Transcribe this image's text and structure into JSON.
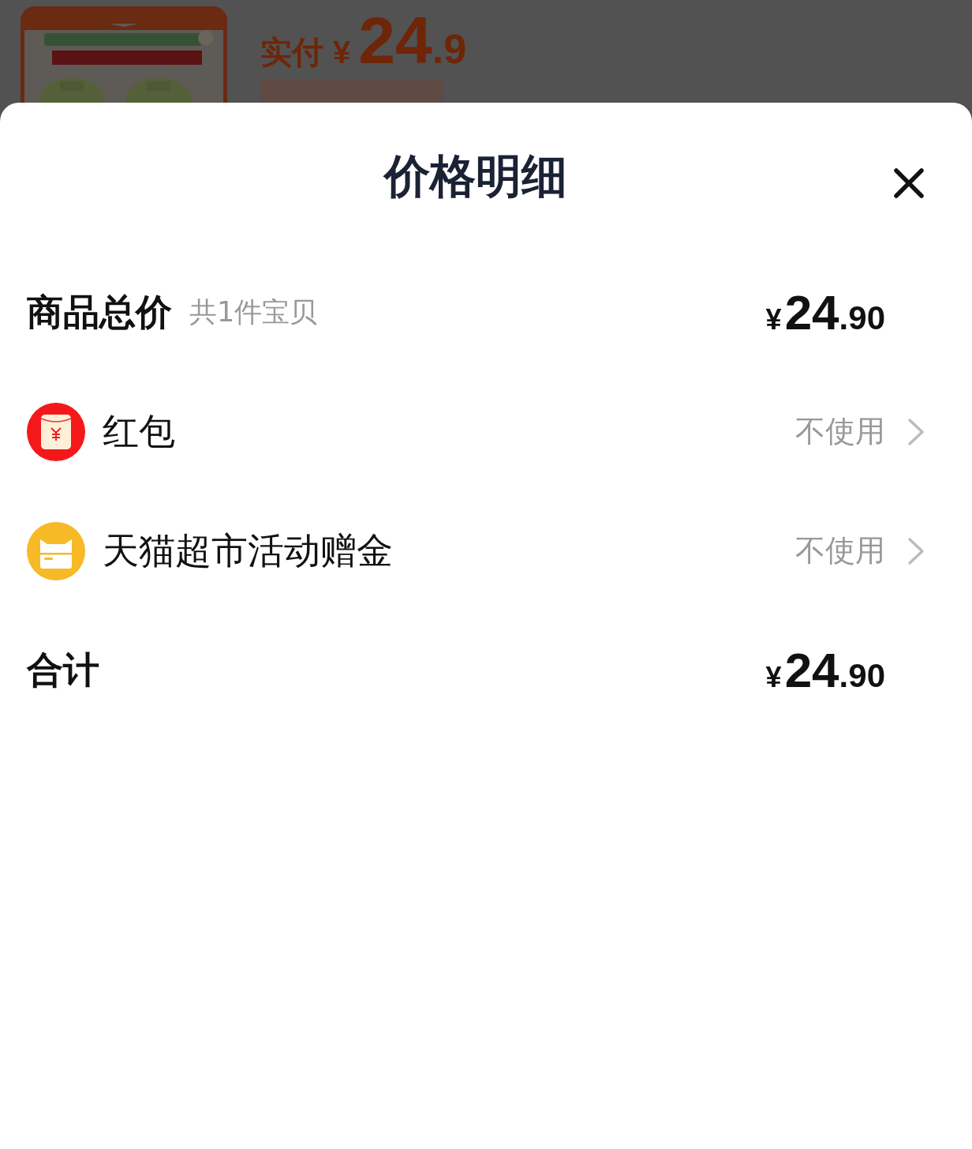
{
  "background_page": {
    "paid_label": "实付",
    "price": {
      "currency": "¥",
      "integer": "24",
      "decimal": ".9"
    },
    "detail_button": {
      "kind": "cut"
    }
  },
  "sheet": {
    "title": "价格明细",
    "rows": [
      {
        "kind": "total",
        "label": "商品总价",
        "note": "共1件宝贝",
        "price": {
          "currency": "¥",
          "integer": "24",
          "decimal": ".90"
        }
      },
      {
        "kind": "option",
        "label": "红包",
        "value": "不使用"
      },
      {
        "kind": "option",
        "label": "天猫超市活动赠金",
        "value": "不使用"
      },
      {
        "kind": "total",
        "label": "合计",
        "price": {
          "currency": "¥",
          "integer": "24",
          "decimal": ".90"
        }
      }
    ]
  }
}
